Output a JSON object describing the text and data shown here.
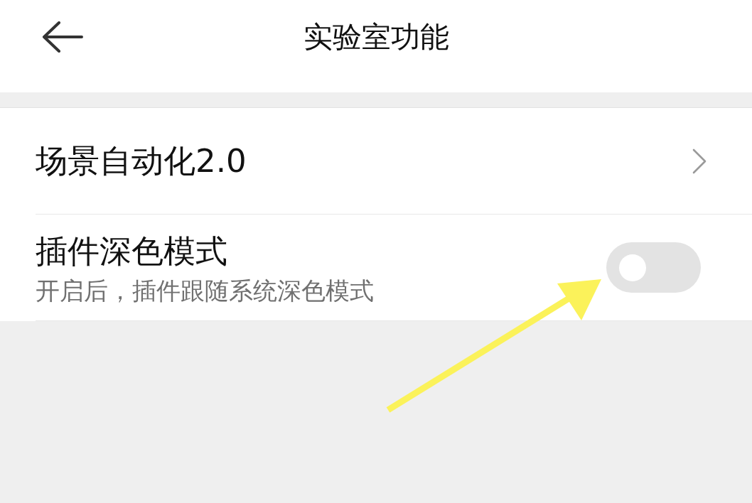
{
  "header": {
    "title": "实验室功能"
  },
  "items": [
    {
      "kind": "link",
      "title": "场景自动化2.0"
    },
    {
      "kind": "toggle",
      "title": "插件深色模式",
      "subtitle": "开启后，插件跟随系统深色模式",
      "on": false
    }
  ]
}
